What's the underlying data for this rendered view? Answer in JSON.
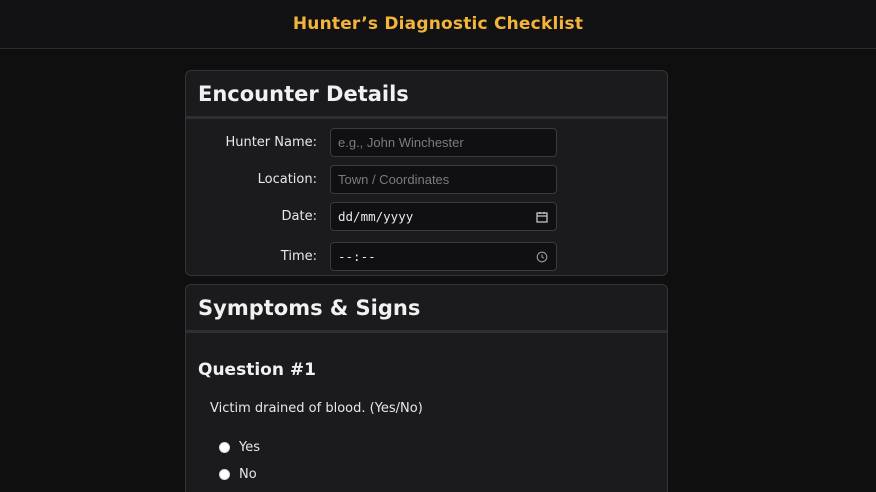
{
  "app": {
    "title": "Hunter’s Diagnostic Checklist"
  },
  "encounter": {
    "title": "Encounter Details",
    "fields": [
      {
        "label": "Hunter Name:",
        "placeholder": "e.g., John Winchester",
        "icon": ""
      },
      {
        "label": "Location:",
        "placeholder": "Town / Coordinates",
        "icon": ""
      },
      {
        "label": "Date:",
        "value": "dd/mm/yyyy",
        "icon": "calendar-icon"
      },
      {
        "label": "Time:",
        "value": "--:--",
        "icon": "clock-icon"
      }
    ]
  },
  "symptoms": {
    "title": "Symptoms & Signs",
    "question": {
      "title": "Question #1",
      "text": "Victim drained of blood. (Yes/No)",
      "options": [
        "Yes",
        "No"
      ]
    }
  },
  "colors": {
    "accent": "#f4b43a",
    "background": "#0f0f10",
    "card": "#1b1b1e"
  }
}
